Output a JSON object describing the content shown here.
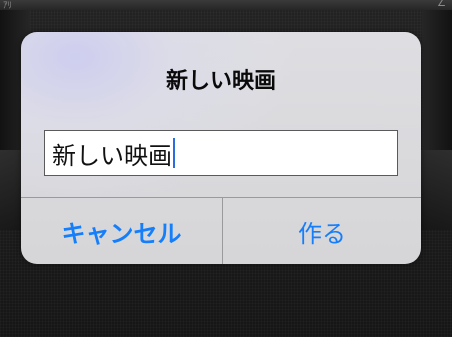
{
  "background": {
    "top_left_text": "ｱﾘ",
    "top_right_icon": "pencil-icon"
  },
  "alert": {
    "title": "新しい映画",
    "input": {
      "value": "新しい映画",
      "placeholder": ""
    },
    "buttons": {
      "cancel_label": "キャンセル",
      "create_label": "作る"
    }
  },
  "colors": {
    "accent": "#157efb",
    "cursor": "#2b6de0",
    "alert_background": "#dcdcdf",
    "backdrop": "#1c1c1c"
  }
}
